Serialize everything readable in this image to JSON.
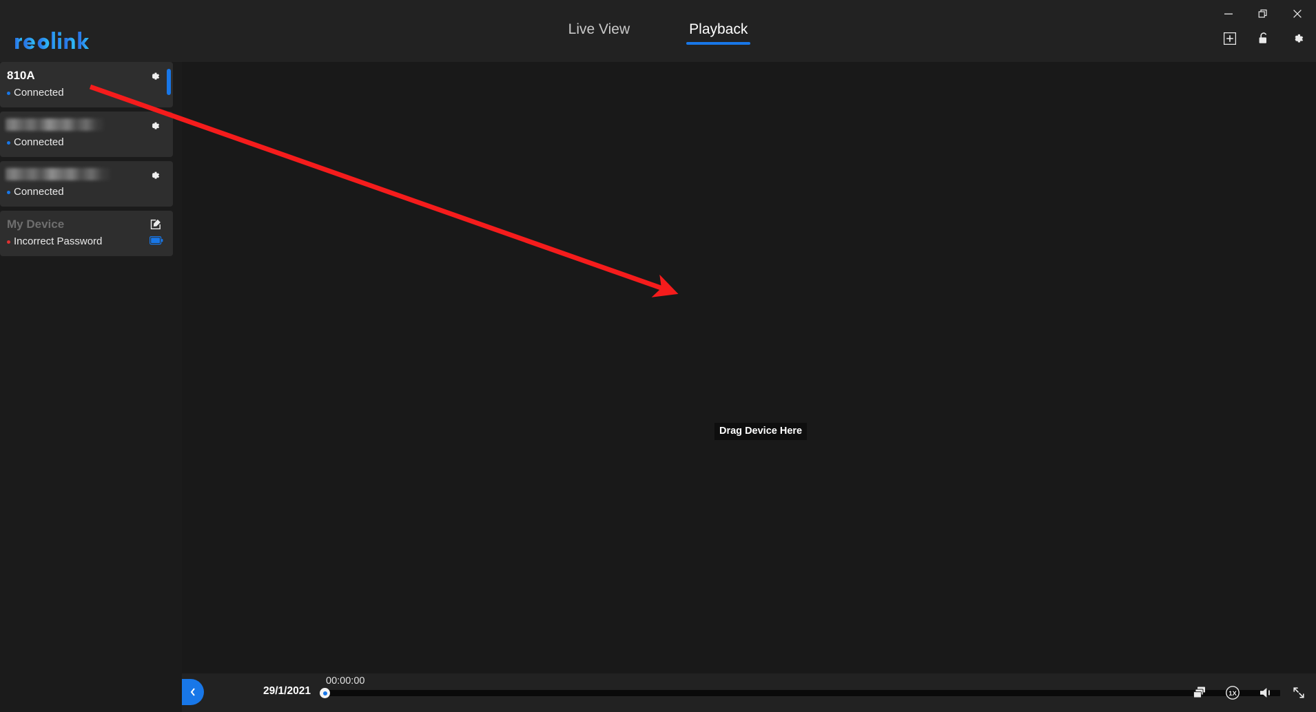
{
  "window": {
    "minimize_label": "minimize",
    "restore_label": "restore",
    "close_label": "close"
  },
  "brand": {
    "name": "reolink"
  },
  "header": {
    "tabs": [
      {
        "label": "Live View",
        "active": false
      },
      {
        "label": "Playback",
        "active": true
      }
    ],
    "icons": [
      {
        "name": "add-device-icon"
      },
      {
        "name": "lock-icon"
      },
      {
        "name": "gear-icon"
      }
    ],
    "accent_color": "#1877e8"
  },
  "sidebar": {
    "devices": [
      {
        "name": "810A",
        "status": "Connected",
        "status_color": "#1877e8",
        "blurred": false,
        "selected": true
      },
      {
        "name": "",
        "status": "Connected",
        "status_color": "#1877e8",
        "blurred": true,
        "selected": false
      },
      {
        "name": "",
        "status": "Connected",
        "status_color": "#1877e8",
        "blurred": true,
        "selected": false
      },
      {
        "name": "My Device",
        "status": "Incorrect Password",
        "status_color": "#e03131",
        "blurred": false,
        "selected": false,
        "disabled": true
      }
    ]
  },
  "stage": {
    "drop_hint": "Drag Device Here"
  },
  "playback_bar": {
    "back_label": "back",
    "date": "29/1/2021",
    "time": "00:00:00",
    "progress_percent": 0,
    "speed": "1X",
    "icons": [
      {
        "name": "sliders-icon"
      },
      {
        "name": "layers-icon"
      },
      {
        "name": "speed-icon"
      },
      {
        "name": "volume-icon"
      },
      {
        "name": "fullscreen-icon"
      }
    ]
  }
}
